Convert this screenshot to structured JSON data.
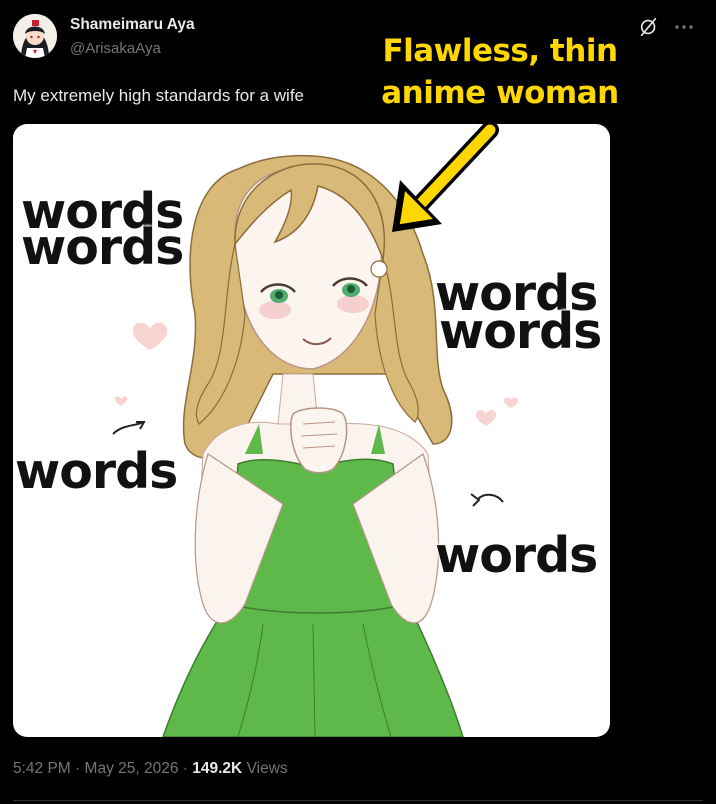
{
  "author": {
    "name": "Shameimaru Aya",
    "handle": "@ArisakaAya"
  },
  "tweet": {
    "text": "My extremely high standards for a wife"
  },
  "overlay": {
    "caption_line1": "Flawless, thin",
    "caption_line2": "anime woman",
    "color": "#ffd700"
  },
  "media": {
    "words_top_left_1": "words",
    "words_top_left_2": "words",
    "words_right_1": "words",
    "words_right_2": "words",
    "words_mid_left": "words",
    "words_bottom_right": "words",
    "dress_color": "#5fb94a",
    "hair_color": "#d8b978"
  },
  "meta": {
    "time": "5:42 PM",
    "separator": "·",
    "date": "May 25, 2026",
    "views_count": "149.2K",
    "views_label": "Views"
  },
  "icons": {
    "grok": "grok-icon",
    "more": "more-icon"
  }
}
